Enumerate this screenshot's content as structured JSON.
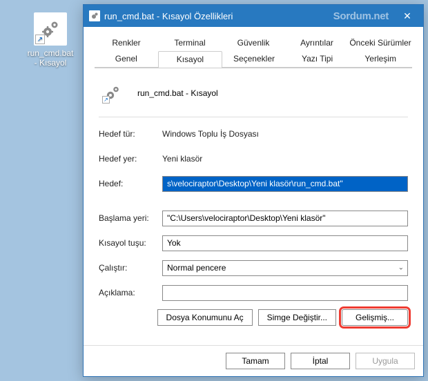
{
  "desktop": {
    "shortcut_label": "run_cmd.bat - Kısayol"
  },
  "dialog": {
    "title": "run_cmd.bat - Kısayol Özellikleri",
    "watermark": "Sordum.net",
    "tabs_top": [
      "Renkler",
      "Terminal",
      "Güvenlik",
      "Ayrıntılar",
      "Önceki Sürümler"
    ],
    "tabs_bottom": [
      "Genel",
      "Kısayol",
      "Seçenekler",
      "Yazı Tipi",
      "Yerleşim"
    ],
    "active_tab": "Kısayol",
    "shortcut_name": "run_cmd.bat - Kısayol",
    "labels": {
      "target_type": "Hedef tür:",
      "target_loc": "Hedef yer:",
      "target": "Hedef:",
      "start_in": "Başlama yeri:",
      "hotkey": "Kısayol tuşu:",
      "run": "Çalıştır:",
      "comment": "Açıklama:"
    },
    "values": {
      "target_type": "Windows Toplu İş Dosyası",
      "target_loc": "Yeni klasör",
      "target": "s\\velociraptor\\Desktop\\Yeni klasör\\run_cmd.bat\"",
      "start_in": "\"C:\\Users\\velociraptor\\Desktop\\Yeni klasör\"",
      "hotkey": "Yok",
      "run": "Normal pencere",
      "comment": ""
    },
    "buttons": {
      "open_loc": "Dosya Konumunu Aç",
      "change_icon": "Simge Değiştir...",
      "advanced": "Gelişmiş..."
    },
    "footer": {
      "ok": "Tamam",
      "cancel": "İptal",
      "apply": "Uygula"
    }
  }
}
